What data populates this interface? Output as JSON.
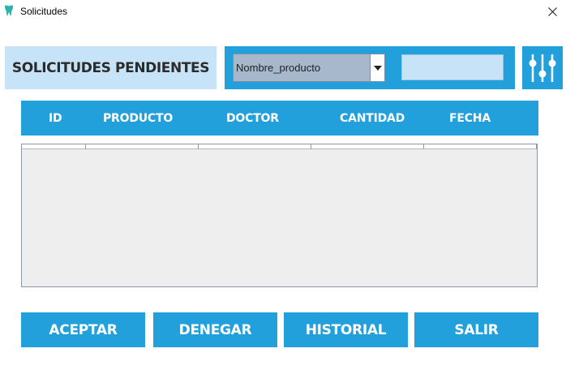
{
  "window": {
    "title": "Solicitudes",
    "icon": "tooth-icon"
  },
  "header": {
    "title": "SOLICITUDES PENDIENTES"
  },
  "filter": {
    "selected": "Nombre_producto",
    "search_value": "",
    "filter_icon": "sliders-icon"
  },
  "table": {
    "columns": [
      "ID",
      "PRODUCTO",
      "DOCTOR",
      "CANTIDAD",
      "FECHA"
    ],
    "rows": []
  },
  "actions": {
    "accept": "ACEPTAR",
    "deny": "DENEGAR",
    "history": "HISTORIAL",
    "exit": "SALIR"
  },
  "colors": {
    "accent": "#22a0dc",
    "light_accent": "#c6e3f7",
    "table_bg": "#eeeeee"
  }
}
